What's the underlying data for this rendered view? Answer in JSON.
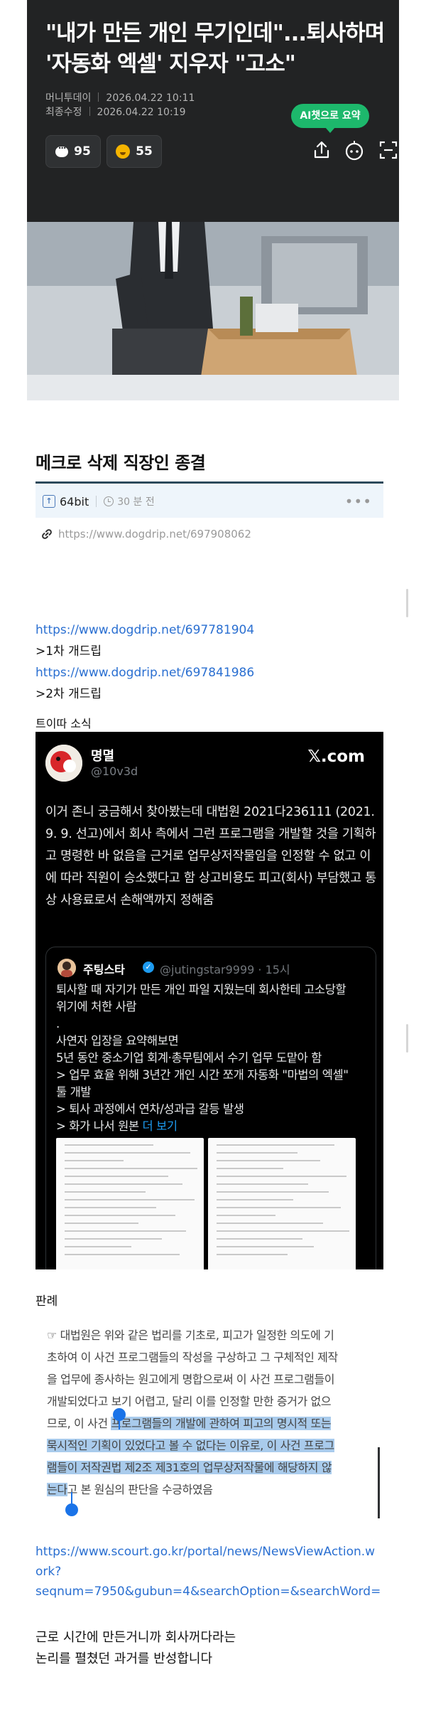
{
  "article": {
    "title_line1": "\"내가 만든 개인 무기인데\"...퇴사하며",
    "title_line2": "'자동화 엑셀' 지우자 \"고소\"",
    "publisher": "머니투데이",
    "published_label": "",
    "published_date": "2026.04.22 10:11",
    "modified_label": "최종수정",
    "modified_date": "2026.04.22 10:19",
    "ai_summary_label": "AI챗으로 요약",
    "comment_count": "95",
    "reaction_count": "55",
    "icons": [
      "comment-bubble-icon",
      "reaction-emoji-icon",
      "share-icon",
      "ai-robot-icon",
      "scan-icon"
    ],
    "accent_color": "#1db86c"
  },
  "post": {
    "title": "메크로 삭제 직장인 종결",
    "author": "64bit",
    "time_ago": "30 분 전",
    "more_label": "•••",
    "permalink": "https://www.dogdrip.net/697908062"
  },
  "body": {
    "link1": "https://www.dogdrip.net/697781904",
    "link1_note": ">1차 개드립",
    "link2": "https://www.dogdrip.net/697841986",
    "link2_note": ">2차 개드립",
    "twitter_label": "트이따 소식"
  },
  "tweet": {
    "name": "명멸",
    "handle": "@10v3d",
    "brand": "𝕏.com",
    "text": "이거 존니 궁금해서 찾아봤는데 대법원 2021다236111 (2021. 9. 9. 선고)에서 회사 측에서 그런 프로그램을 개발할 것을 기획하고 명령한 바 없음을 근거로 업무상저작물임을 인정할 수 없고 이에 따라 직원이 승소했다고 함 상고비용도 피고(회사) 부담했고 통상 사용료로서 손해액까지 정해줌",
    "quote": {
      "name": "주팅스타",
      "handle": "@jutingstar9999 · 15시",
      "lines": [
        "퇴사할 때 자기가 만든 개인 파일 지웠는데 회사한테 고소당할",
        "위기에 처한 사람",
        ".",
        "사연자 입장을 요약해보면",
        "5년 동안 중소기업 회계·총무팀에서 수기 업무 도맡아 함",
        "> 업무 효율 위해 3년간 개인 시간 쪼개 자동화 \"마법의 엑셀\"",
        "툴 개발",
        "> 퇴사 과정에서 연차/성과급 갈등 발생",
        "> 화가 나서 원본"
      ],
      "more": "더 보기"
    }
  },
  "ruling": {
    "label": "판례",
    "line1": "☞ 대법원은 위와 같은 법리를 기초로, 피고가 일정한 의도에 기",
    "line2": "초하여 이 사건 프로그램들의 작성을 구상하고 그 구체적인 제작",
    "line3": "을 업무에 종사하는 원고에게 명합으로써 이 사건 프로그램들이",
    "line4": "개발되었다고 보기 어렵고, 달리 이를 인정할 만한 증거가 없으",
    "line5_plain": "므로, 이 사건 ",
    "line5_hl": "프로그램들의 개발에 관하여 피고의 명시적 또는",
    "line6_hl": "묵시적인 기획이 있었다고 볼 수 없다는 이유로, 이 사건 프로그",
    "line7_hl": "램들이 저작권법 제2조 제31호의 업무상저작물에 해당하지 않",
    "line8_hl": "는다",
    "line8_plain": "고 본 원심의 판단을 수긍하였음"
  },
  "source": {
    "url_line1": "https://www.scourt.go.kr/portal/news/NewsViewAction.w",
    "url_line2": "ork?",
    "url_line3": "seqnum=7950&gubun=4&searchOption=&searchWord="
  },
  "closing": {
    "line1": "근로 시간에 만든거니까 회사꺼다라는",
    "line2": "논리를 펼쳤던 과거를 반성합니다"
  }
}
